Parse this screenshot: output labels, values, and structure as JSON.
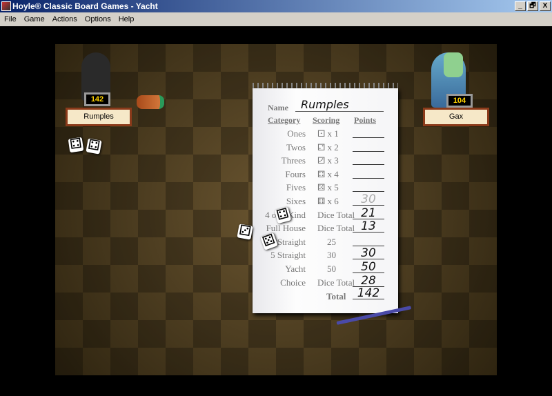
{
  "window": {
    "title": "Hoyle® Classic Board Games - Yacht",
    "buttons": [
      "_",
      "🗗",
      "X"
    ]
  },
  "menu": [
    "File",
    "Game",
    "Actions",
    "Options",
    "Help"
  ],
  "players": [
    {
      "name": "Rumples",
      "score": "142"
    },
    {
      "name": "Gax",
      "score": "104"
    }
  ],
  "scorecard": {
    "name_label": "Name",
    "name": "Rumples",
    "headers": [
      "Category",
      "Scoring",
      "Points"
    ],
    "rows": [
      {
        "category": "Ones",
        "scoring": "⚀ x 1",
        "points": ""
      },
      {
        "category": "Twos",
        "scoring": "⚁ x 2",
        "points": ""
      },
      {
        "category": "Threes",
        "scoring": "⚂ x 3",
        "points": ""
      },
      {
        "category": "Fours",
        "scoring": "⚃ x 4",
        "points": ""
      },
      {
        "category": "Fives",
        "scoring": "⚄ x 5",
        "points": ""
      },
      {
        "category": "Sixes",
        "scoring": "⚅ x 6",
        "points": "30",
        "tentative": true
      },
      {
        "category": "4 of a Kind",
        "scoring": "Dice Total",
        "points": "21"
      },
      {
        "category": "Full House",
        "scoring": "Dice Total",
        "points": "13"
      },
      {
        "category": "4 Straight",
        "scoring": "25",
        "points": ""
      },
      {
        "category": "5 Straight",
        "scoring": "30",
        "points": "30"
      },
      {
        "category": "Yacht",
        "scoring": "50",
        "points": "50"
      },
      {
        "category": "Choice",
        "scoring": "Dice Total",
        "points": "28"
      }
    ],
    "total_label": "Total",
    "total": "142"
  },
  "dice": [
    "⚃",
    "⚃",
    "⚃",
    "⚂",
    "⚄"
  ]
}
